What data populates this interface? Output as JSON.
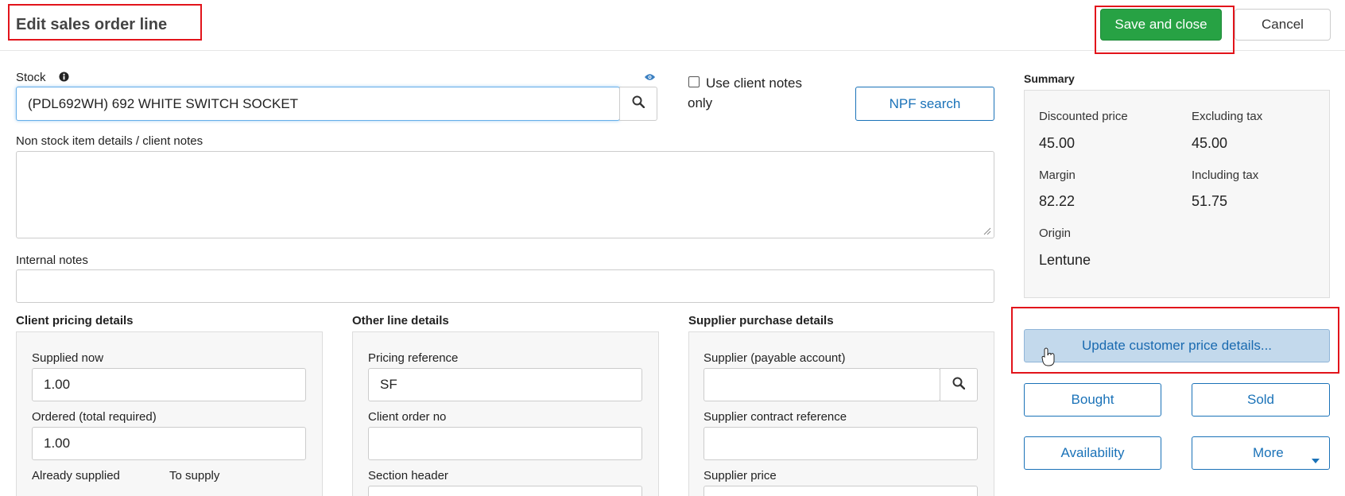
{
  "header": {
    "title": "Edit sales order line",
    "save_label": "Save and close",
    "cancel_label": "Cancel"
  },
  "stock": {
    "label": "Stock",
    "value": "(PDL692WH) 692 WHITE SWITCH SOCKET",
    "info_icon": "info-icon",
    "eye_icon": "eye-icon",
    "search_icon": "search-icon"
  },
  "client_notes": {
    "checkbox_label": "Use client notes only",
    "checked": false
  },
  "npf_search_label": "NPF search",
  "non_stock_label": "Non stock item details / client notes",
  "internal_notes_label": "Internal notes",
  "client_pricing": {
    "title": "Client pricing details",
    "supplied_now_label": "Supplied now",
    "supplied_now_value": "1.00",
    "ordered_label": "Ordered (total required)",
    "ordered_value": "1.00",
    "already_supplied_label": "Already supplied",
    "to_supply_label": "To supply"
  },
  "other_line": {
    "title": "Other line details",
    "pricing_ref_label": "Pricing reference",
    "pricing_ref_value": "SF",
    "client_order_label": "Client order no",
    "client_order_value": "",
    "section_header_label": "Section header"
  },
  "supplier": {
    "title": "Supplier purchase details",
    "payable_label": "Supplier (payable account)",
    "payable_value": "",
    "contract_ref_label": "Supplier contract reference",
    "contract_ref_value": "",
    "price_label": "Supplier price"
  },
  "summary": {
    "title": "Summary",
    "discounted_price_label": "Discounted price",
    "discounted_price_value": "45.00",
    "excluding_tax_label": "Excluding tax",
    "excluding_tax_value": "45.00",
    "margin_label": "Margin",
    "margin_value": "82.22",
    "including_tax_label": "Including tax",
    "including_tax_value": "51.75",
    "origin_label": "Origin",
    "origin_value": "Lentune"
  },
  "actions": {
    "update_label": "Update customer price details...",
    "bought_label": "Bought",
    "sold_label": "Sold",
    "availability_label": "Availability",
    "more_label": "More"
  },
  "colors": {
    "primary": "#1a72b8",
    "save_green": "#27a244",
    "highlight_red": "#e2141b"
  }
}
